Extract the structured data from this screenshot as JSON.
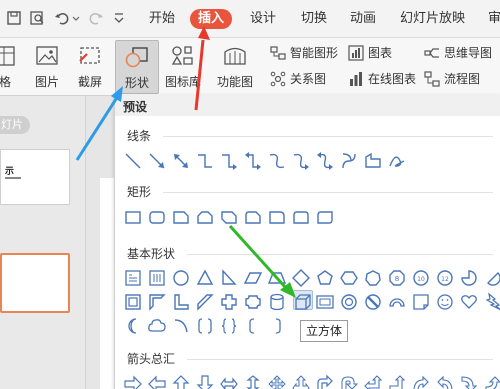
{
  "quick_access": {
    "icons": [
      "save-icon",
      "print-preview-icon",
      "undo-icon",
      "redo-icon",
      "dropdown-icon"
    ]
  },
  "tabs": [
    {
      "label": "开始"
    },
    {
      "label": "插入",
      "active": true
    },
    {
      "label": "设计"
    },
    {
      "label": "切换"
    },
    {
      "label": "动画"
    },
    {
      "label": "幻灯片放映"
    },
    {
      "label": "审"
    }
  ],
  "ribbon": {
    "table_partial": "格",
    "picture": "图片",
    "screenshot": "截屏",
    "shapes": "形状",
    "icon_lib": "图标库",
    "function_chart": "功能图",
    "smart_graphic": "智能图形",
    "relation_graph": "关系图",
    "chart": "图表",
    "online_chart": "在线图表",
    "mind_map": "思维导图",
    "flowchart": "流程图"
  },
  "left_panel": {
    "slides_tab": "灯片",
    "thumb1_title": "示"
  },
  "shapes_dropdown": {
    "header": "预设",
    "sections": {
      "lines": "线条",
      "rectangles": "矩形",
      "basic": "基本形状",
      "arrows": "箭头总汇"
    },
    "hovered_shape_tooltip": "立方体"
  },
  "colors": {
    "accent_tab": "#e9543d",
    "shape_stroke": "#4a76b8",
    "arrow_red": "#e8382b",
    "arrow_blue": "#2d9be8",
    "arrow_green": "#2fb82a"
  }
}
